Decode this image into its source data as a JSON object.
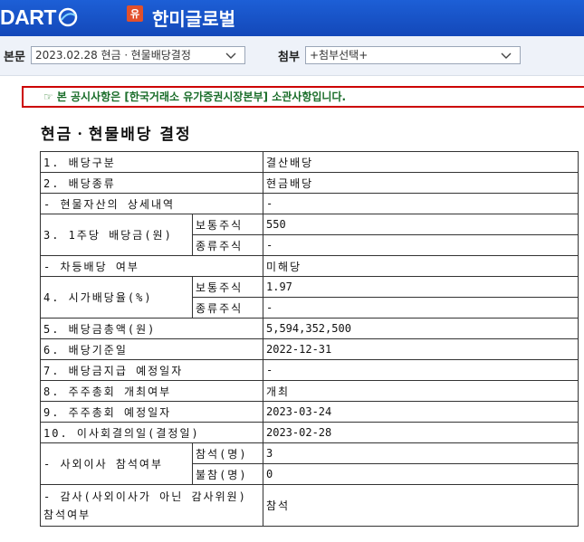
{
  "header": {
    "logo_text": "DART",
    "corp_badge": "유",
    "corp_name": "한미글로벌"
  },
  "selection": {
    "main_label": "본문",
    "main_value": "2023.02.28  현금ㆍ현물배당결정",
    "attach_label": "첨부",
    "attach_value": "+첨부선택+"
  },
  "notice": {
    "icon": "hand-pointer-icon",
    "text": "본 공시사항은 [한국거래소 유가증권시장본부] 소관사항입니다."
  },
  "doc": {
    "title": "현금ㆍ현물배당 결정",
    "rows": {
      "r1_label": "1. 배당구분",
      "r1_value": "결산배당",
      "r2_label": "2. 배당종류",
      "r2_value": "현금배당",
      "r3_label": "- 현물자산의 상세내역",
      "r3_value": "-",
      "r4_label": "3. 1주당 배당금(원)",
      "r4_sub1": "보통주식",
      "r4_val1": "550",
      "r4_sub2": "종류주식",
      "r4_val2": "-",
      "r5_label": "- 차등배당 여부",
      "r5_value": "미해당",
      "r6_label": "4. 시가배당율(%)",
      "r6_sub1": "보통주식",
      "r6_val1": "1.97",
      "r6_sub2": "종류주식",
      "r6_val2": "-",
      "r7_label": "5. 배당금총액(원)",
      "r7_value": "5,594,352,500",
      "r8_label": "6. 배당기준일",
      "r8_value": "2022-12-31",
      "r9_label": "7. 배당금지급 예정일자",
      "r9_value": "-",
      "r10_label": "8. 주주총회 개최여부",
      "r10_value": "개최",
      "r11_label": "9. 주주총회 예정일자",
      "r11_value": "2023-03-24",
      "r12_label": "10. 이사회결의일(결정일)",
      "r12_value": "2023-02-28",
      "r13_label": "- 사외이사 참석여부",
      "r13_sub1": "참석(명)",
      "r13_val1": "3",
      "r13_sub2": "불참(명)",
      "r13_val2": "0",
      "r14_label": "- 감사(사외이사가 아닌 감사위원) 참석여부",
      "r14_value": "참석"
    }
  }
}
